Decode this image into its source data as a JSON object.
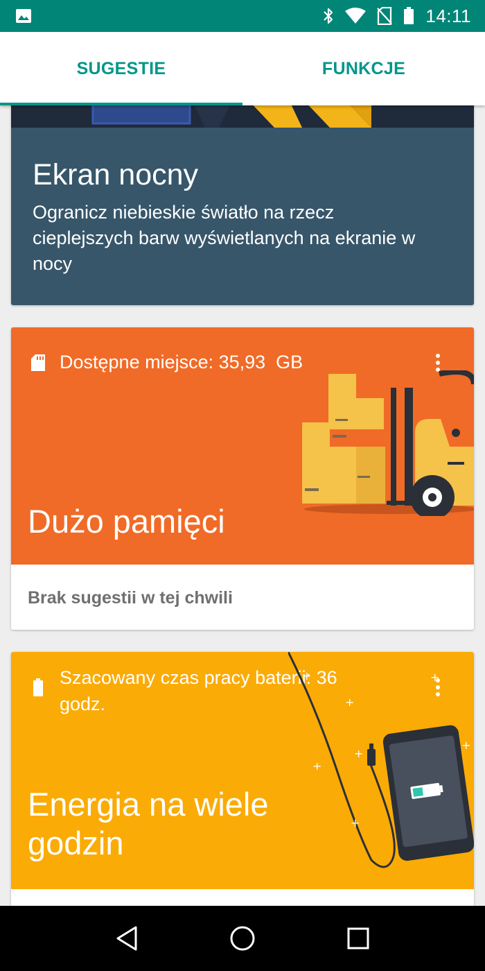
{
  "status_bar": {
    "time": "14:11",
    "icons": [
      "image-icon",
      "bluetooth-icon",
      "wifi-icon",
      "no-sim-icon",
      "battery-icon"
    ]
  },
  "tabs": [
    {
      "label": "SUGESTIE",
      "selected": true
    },
    {
      "label": "FUNKCJE",
      "selected": false
    }
  ],
  "cards": {
    "night": {
      "title": "Ekran nocny",
      "description": "Ogranicz niebieskie światło na rzecz cieplejszych barw wyświetlanych na ekranie w nocy",
      "background": "#37566a"
    },
    "storage": {
      "status": "Dostępne miejsce: 35,93  GB",
      "title": "Dużo pamięci",
      "footer": "Brak sugestii w tej chwili",
      "icon": "sd-card-icon",
      "background": "#f06b27"
    },
    "battery": {
      "status": "Szacowany czas pracy baterii: 36 godz.",
      "title": "Energia na wiele godzin",
      "icon": "battery-icon",
      "background": "#fbab05"
    }
  },
  "nav": [
    "back-icon",
    "home-icon",
    "recents-icon"
  ],
  "colors": {
    "status_bar": "#008577",
    "accent": "#009688"
  }
}
